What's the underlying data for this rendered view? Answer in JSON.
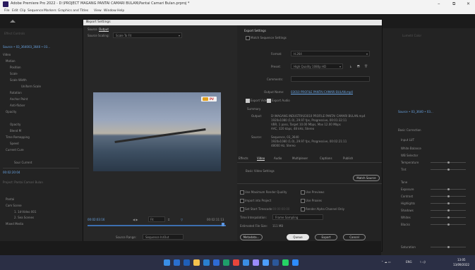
{
  "window": {
    "title": "Adobe Premiere Pro 2022 - D:\\PROJECT MAGANG PANTAI CAMARI BULAN\\Pantai Camari Bulan.prproj *",
    "minimize": "–",
    "restore": "⧉",
    "close": "✕"
  },
  "menu": [
    "File",
    "Edit",
    "Clip",
    "Sequence",
    "Markers",
    "Graphics and Titles",
    "View",
    "Window",
    "Help"
  ],
  "home_icon": "home-icon",
  "left_panel": {
    "tabs": "Effect Controls",
    "source_label": "Source • 03_3640",
    "clip_label": "03_3640 • 03...",
    "video_header": "Video",
    "rows": [
      "Motion",
      "Position",
      "Scale",
      "Scale Width",
      "Uniform Scale",
      "Rotation",
      "Anchor Point",
      "Anti-flicker",
      "Opacity",
      "Opacity",
      "Blend M",
      "Time Remapping",
      "Speed",
      "Current Cure",
      "Sour Current"
    ],
    "timecode": "00:02:20:04",
    "project_label": "Project: Pantai Camari Bulan",
    "items": [
      "Pantai",
      "Cam Scene",
      "1. 1d-Video 001",
      "2. Sea Scenes",
      "Mixed Media"
    ]
  },
  "dialog": {
    "title": "Export Settings",
    "close": "✕",
    "source_tabs": [
      "Source",
      "Output"
    ],
    "source_scaling_label": "Source Scaling:",
    "source_scaling_value": "Scale To Fit",
    "preview_logo": "PV",
    "timecode_start": "00:02:03:16",
    "timecode_end": "00:02:11:13",
    "fit_label": "Fit",
    "source_range_label": "Source Range:",
    "source_range_value": "Sequence In/Out",
    "export_settings_header": "Export Settings",
    "match_sequence": "Match Sequence Settings",
    "format_label": "Format:",
    "format_value": "H.264",
    "preset_label": "Preset:",
    "preset_value": "High Quality 1080p HD",
    "comments_label": "Comments:",
    "output_name_label": "Output Name:",
    "output_name_value": "03010 PROFILE PANTAI CAMARI BULAN.mp4",
    "export_video": "Export Video",
    "export_audio": "Export Audio",
    "summary_header": "Summary",
    "output_label": "Output:",
    "output_text": [
      "D:\\MAGANG INDUSTRI\\03010 PROFILE PANTAI CAMARI BULAN.mp4",
      "1920x1080 (1.0), 29.97 fps, Progressive, 00:01:32:11",
      "VBR, 1 pass, Target 10.00 Mbps, Max 12.00 Mbps",
      "AAC, 320 kbps, 48 kHz, Stereo"
    ],
    "source_label": "Source:",
    "source_text": [
      "Sequence, 03_3640",
      "1920x1080 (1.0), 29.97 fps, Progressive, 00:02:21:11",
      "48000 Hz, Stereo"
    ],
    "tabs": [
      "Effects",
      "Video",
      "Audio",
      "Multiplexer",
      "Captions",
      "Publish"
    ],
    "basic_video_header": "Basic Video Settings",
    "match_source": "Match Source",
    "max_render": "Use Maximum Render Quality",
    "use_previews": "Use Previews",
    "import_project": "Import into Project",
    "use_proxies": "Use Proxies",
    "set_start_tc": "Set Start Timecode",
    "start_tc_value": "00:00:00:00",
    "render_alpha": "Render Alpha Channel Only",
    "time_interp_label": "Time Interpolation:",
    "time_interp_value": "Frame Sampling",
    "file_size_label": "Estimated File Size:",
    "file_size_value": "111 MB",
    "btn_metadata": "Metadata...",
    "btn_queue": "Queue",
    "btn_export": "Export",
    "btn_cancel": "Cancel"
  },
  "right_panel": {
    "labels": [
      "Lumetri Color",
      "Basic Correction",
      "Input LUT",
      "White Balance",
      "WB Selector",
      "Temperature",
      "Tint",
      "Tone",
      "Exposure",
      "Contrast",
      "Highlights",
      "Shadows",
      "Whites",
      "Blacks",
      "Saturation"
    ],
    "clip_label": "Source • 03_3640 • 03..."
  },
  "taskbar": {
    "icons": [
      "windows-icon",
      "search-icon",
      "task-view-icon",
      "file-explorer-icon",
      "store-icon",
      "mail-icon",
      "edge-icon",
      "chrome-icon",
      "photos-icon",
      "premiere-icon",
      "media-encoder-icon",
      "word-icon",
      "whatsapp-icon",
      "zoom-icon"
    ],
    "colors": [
      "#3a8ee6",
      "#2a6fcf",
      "#1f5fb8",
      "#f2c14e",
      "#2a80d0",
      "#2e6bd6",
      "#1e9e6a",
      "#e8453c",
      "#3a8ee6",
      "#9b8cff",
      "#4c9eff",
      "#2b579a",
      "#25d366",
      "#2d8cff"
    ],
    "clock_time": "13:05",
    "clock_date": "13/09/2022",
    "lang": "ENG"
  }
}
